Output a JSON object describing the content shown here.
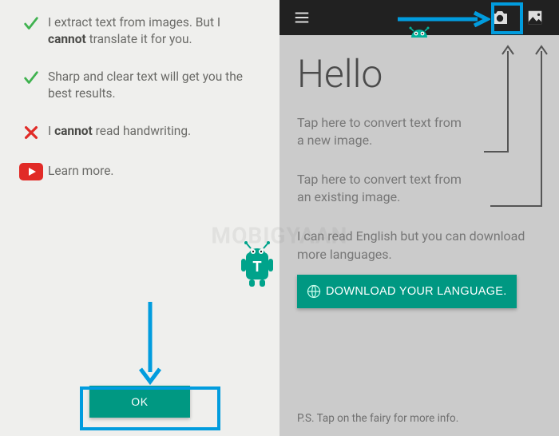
{
  "left": {
    "items": [
      {
        "type": "check",
        "text": "I extract text from images. But I <b>cannot</b> translate it for you."
      },
      {
        "type": "check",
        "text": "Sharp and clear text will get you the best results."
      },
      {
        "type": "cross",
        "text": "I <b>cannot</b> read handwriting."
      },
      {
        "type": "yt",
        "text": "Learn more."
      }
    ],
    "ok_label": "OK"
  },
  "right": {
    "hello": "Hello",
    "tip_camera": "Tap here to convert text from a new image.",
    "tip_gallery": "Tap here to convert text from an existing image.",
    "lang_tip": "I can read English but you can download more languages.",
    "download_label": "DOWNLOAD YOUR LANGUAGE.",
    "ps": "P.S. Tap on the fairy for more info."
  },
  "watermark": "MOBIGYAAN",
  "colors": {
    "accent": "#009882",
    "anno": "#019cde"
  }
}
